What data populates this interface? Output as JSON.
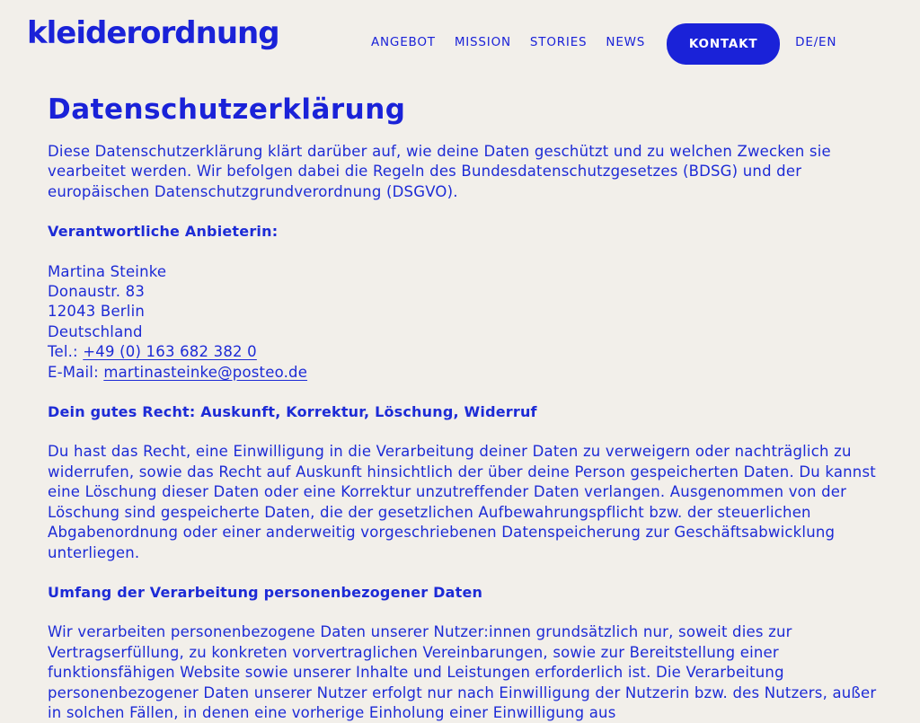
{
  "header": {
    "logo": "kleiderordnung",
    "nav": [
      "ANGEBOT",
      "MISSION",
      "STORIES",
      "NEWS"
    ],
    "contact_label": "KONTAKT",
    "lang": "DE/EN"
  },
  "page": {
    "title": "Datenschutzerklärung",
    "intro": "Diese Datenschutzerklärung klärt darüber auf, wie deine Daten geschützt und zu welchen Zwecken sie vearbeitet werden. Wir befolgen dabei die Regeln des Bundesdatenschutzgesetzes (BDSG) und der europäischen Datenschutzgrundverordnung (DSGVO).",
    "provider_heading": "Verantwortliche Anbieterin:",
    "address": {
      "name": "Martina Steinke",
      "street": "Donaustr. 83",
      "city": "12043 Berlin",
      "country": "Deutschland",
      "tel_label": "Tel.: ",
      "tel": "+49 (0) 163 682 382 0",
      "email_label": "E-Mail: ",
      "email": "martinasteinke@posteo.de"
    },
    "rights_heading": "Dein gutes Recht: Auskunft, Korrektur, Löschung, Widerruf",
    "rights_text": "Du hast das Recht, eine Einwilligung in die Verarbeitung deiner Daten zu verweigern oder nachträglich zu widerrufen, sowie das Recht auf Auskunft hinsichtlich der über deine Person gespeicherten Daten. Du kannst eine Löschung dieser Daten oder eine Korrektur unzutreffender Daten verlangen. Ausgenommen von der Löschung sind gespeicherte Daten, die der gesetzlichen Aufbewahrungspflicht bzw. der steuerlichen Abgabenordnung oder einer anderweitig vorgeschriebenen Datenspeicherung zur Geschäftsabwicklung unterliegen.",
    "scope_heading": "Umfang der Verarbeitung personenbezogener Daten",
    "scope_text": "Wir verarbeiten personenbezogene Daten unserer Nutzer:innen grundsätzlich nur, soweit dies zur Vertragserfüllung, zu konkreten vorvertraglichen Vereinbarungen, sowie zur Bereitstellung einer funktionsfähigen Website sowie unserer Inhalte und Leistungen erforderlich ist. Die Verarbeitung personenbezogener Daten unserer Nutzer erfolgt nur nach Einwilligung der Nutzerin bzw. des Nutzers, außer in solchen Fällen, in denen eine vorherige Einholung einer Einwilligung aus"
  },
  "colors": {
    "accent": "#1a22d8",
    "background": "#f2efea"
  }
}
